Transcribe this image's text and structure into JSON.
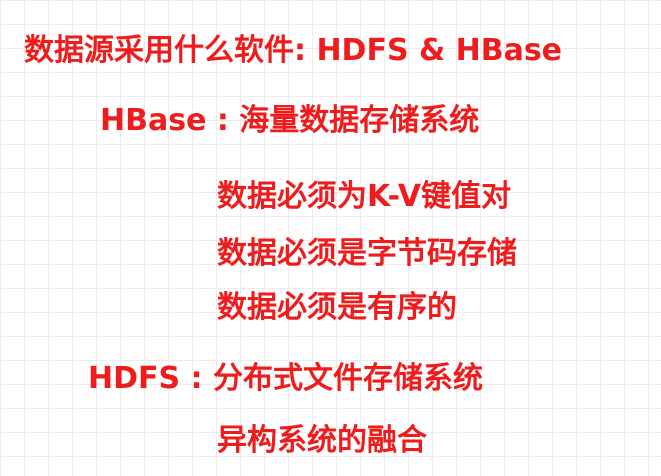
{
  "title": "数据源采用什么软件: HDFS & HBase",
  "hbase_heading": "HBase : 海量数据存储系统",
  "hbase_points": [
    "数据必须为K-V键值对",
    "数据必须是字节码存储",
    "数据必须是有序的"
  ],
  "hdfs_heading": "HDFS : 分布式文件存储系统",
  "footer_point": "异构系统的融合",
  "colors": {
    "text": "#ee1c1c",
    "background": "#ffffff",
    "grid": "#ececec"
  }
}
